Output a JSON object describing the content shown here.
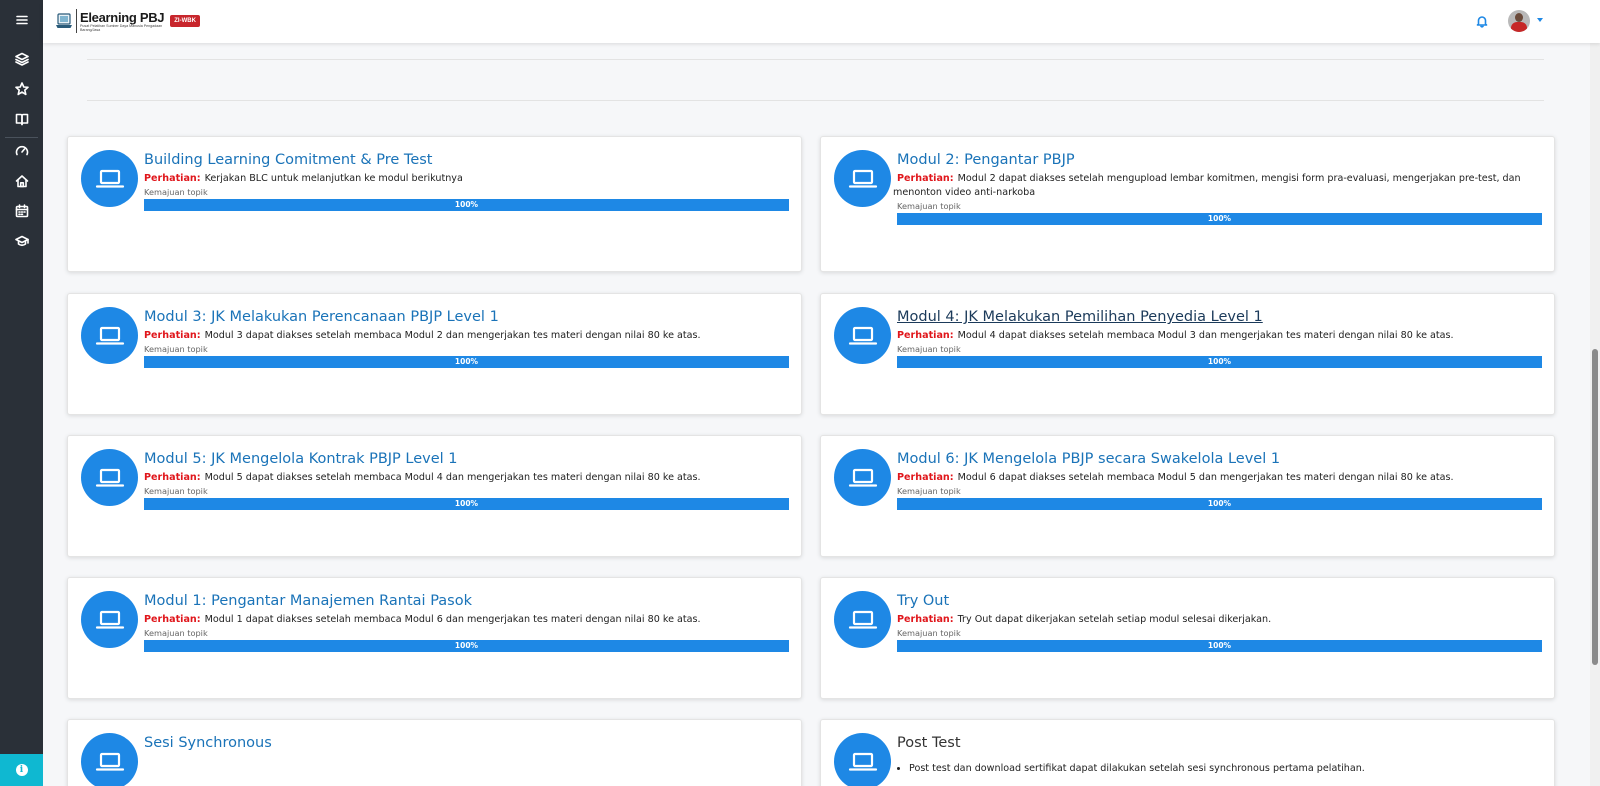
{
  "app": {
    "title": "Elearning PBJ",
    "subtitle": "Pusat Pelatihan Sumber Daya Manusia Pengadaan Barang/Jasa",
    "badge": "ZI-WBK"
  },
  "sidebar": {
    "items": [
      {
        "name": "menu-icon"
      },
      {
        "name": "layers-icon"
      },
      {
        "name": "star-icon"
      },
      {
        "name": "book-icon"
      },
      {
        "name": "gauge-icon"
      },
      {
        "name": "home-icon"
      },
      {
        "name": "calendar-icon"
      },
      {
        "name": "graduation-cap-icon"
      }
    ],
    "help_label": "i"
  },
  "header": {
    "notifications_icon": "bell-icon",
    "user_menu_icon": "chevron-down-icon"
  },
  "colors": {
    "accent": "#1e88e5",
    "warning": "#e0161b",
    "sidebar_bg": "#2a3038",
    "help_bg": "#0fb8d1"
  },
  "progress_label": "Kemajuan topik",
  "warning_label": "Perhatian:",
  "cards": [
    {
      "title": "Building Learning Comitment & Pre Test",
      "note": "Kerjakan BLC untuk melanjutkan ke modul berikutnya",
      "progress": 100,
      "progress_text": "100%"
    },
    {
      "title": "Modul 2: Pengantar PBJP",
      "note": "Modul 2 dapat diakses setelah mengupload lembar komitmen, mengisi form pra-evaluasi, mengerjakan pre-test, dan menonton video anti-narkoba",
      "progress": 100,
      "progress_text": "100%"
    },
    {
      "title": "Modul 3: JK Melakukan Perencanaan PBJP Level 1",
      "note": "Modul 3 dapat diakses setelah membaca Modul 2 dan mengerjakan tes materi dengan nilai 80 ke atas.",
      "progress": 100,
      "progress_text": "100%"
    },
    {
      "title": "Modul 4: JK Melakukan Pemilihan Penyedia Level 1",
      "note": "Modul 4 dapat diakses setelah membaca Modul 3 dan mengerjakan tes materi dengan nilai 80 ke atas.",
      "progress": 100,
      "progress_text": "100%"
    },
    {
      "title": "Modul 5: JK Mengelola Kontrak PBJP Level 1",
      "note": "Modul 5 dapat diakses setelah membaca Modul 4 dan mengerjakan tes materi dengan nilai 80 ke atas.",
      "progress": 100,
      "progress_text": "100%"
    },
    {
      "title": "Modul 6: JK Mengelola PBJP secara Swakelola Level 1",
      "note": "Modul 6 dapat diakses setelah membaca Modul 5 dan mengerjakan tes materi dengan nilai 80 ke atas.",
      "progress": 100,
      "progress_text": "100%"
    },
    {
      "title": "Modul 1: Pengantar Manajemen Rantai Pasok",
      "note": "Modul 1 dapat diakses setelah membaca Modul 6 dan mengerjakan tes materi dengan nilai 80 ke atas.",
      "progress": 100,
      "progress_text": "100%"
    },
    {
      "title": "Try Out",
      "note": "Try Out dapat dikerjakan setelah setiap modul selesai dikerjakan.",
      "progress": 100,
      "progress_text": "100%"
    },
    {
      "title": "Sesi Synchronous"
    },
    {
      "title": "Post Test",
      "bullets": [
        "Post test dan download sertifikat dapat dilakukan setelah sesi synchronous pertama pelatihan."
      ]
    }
  ]
}
